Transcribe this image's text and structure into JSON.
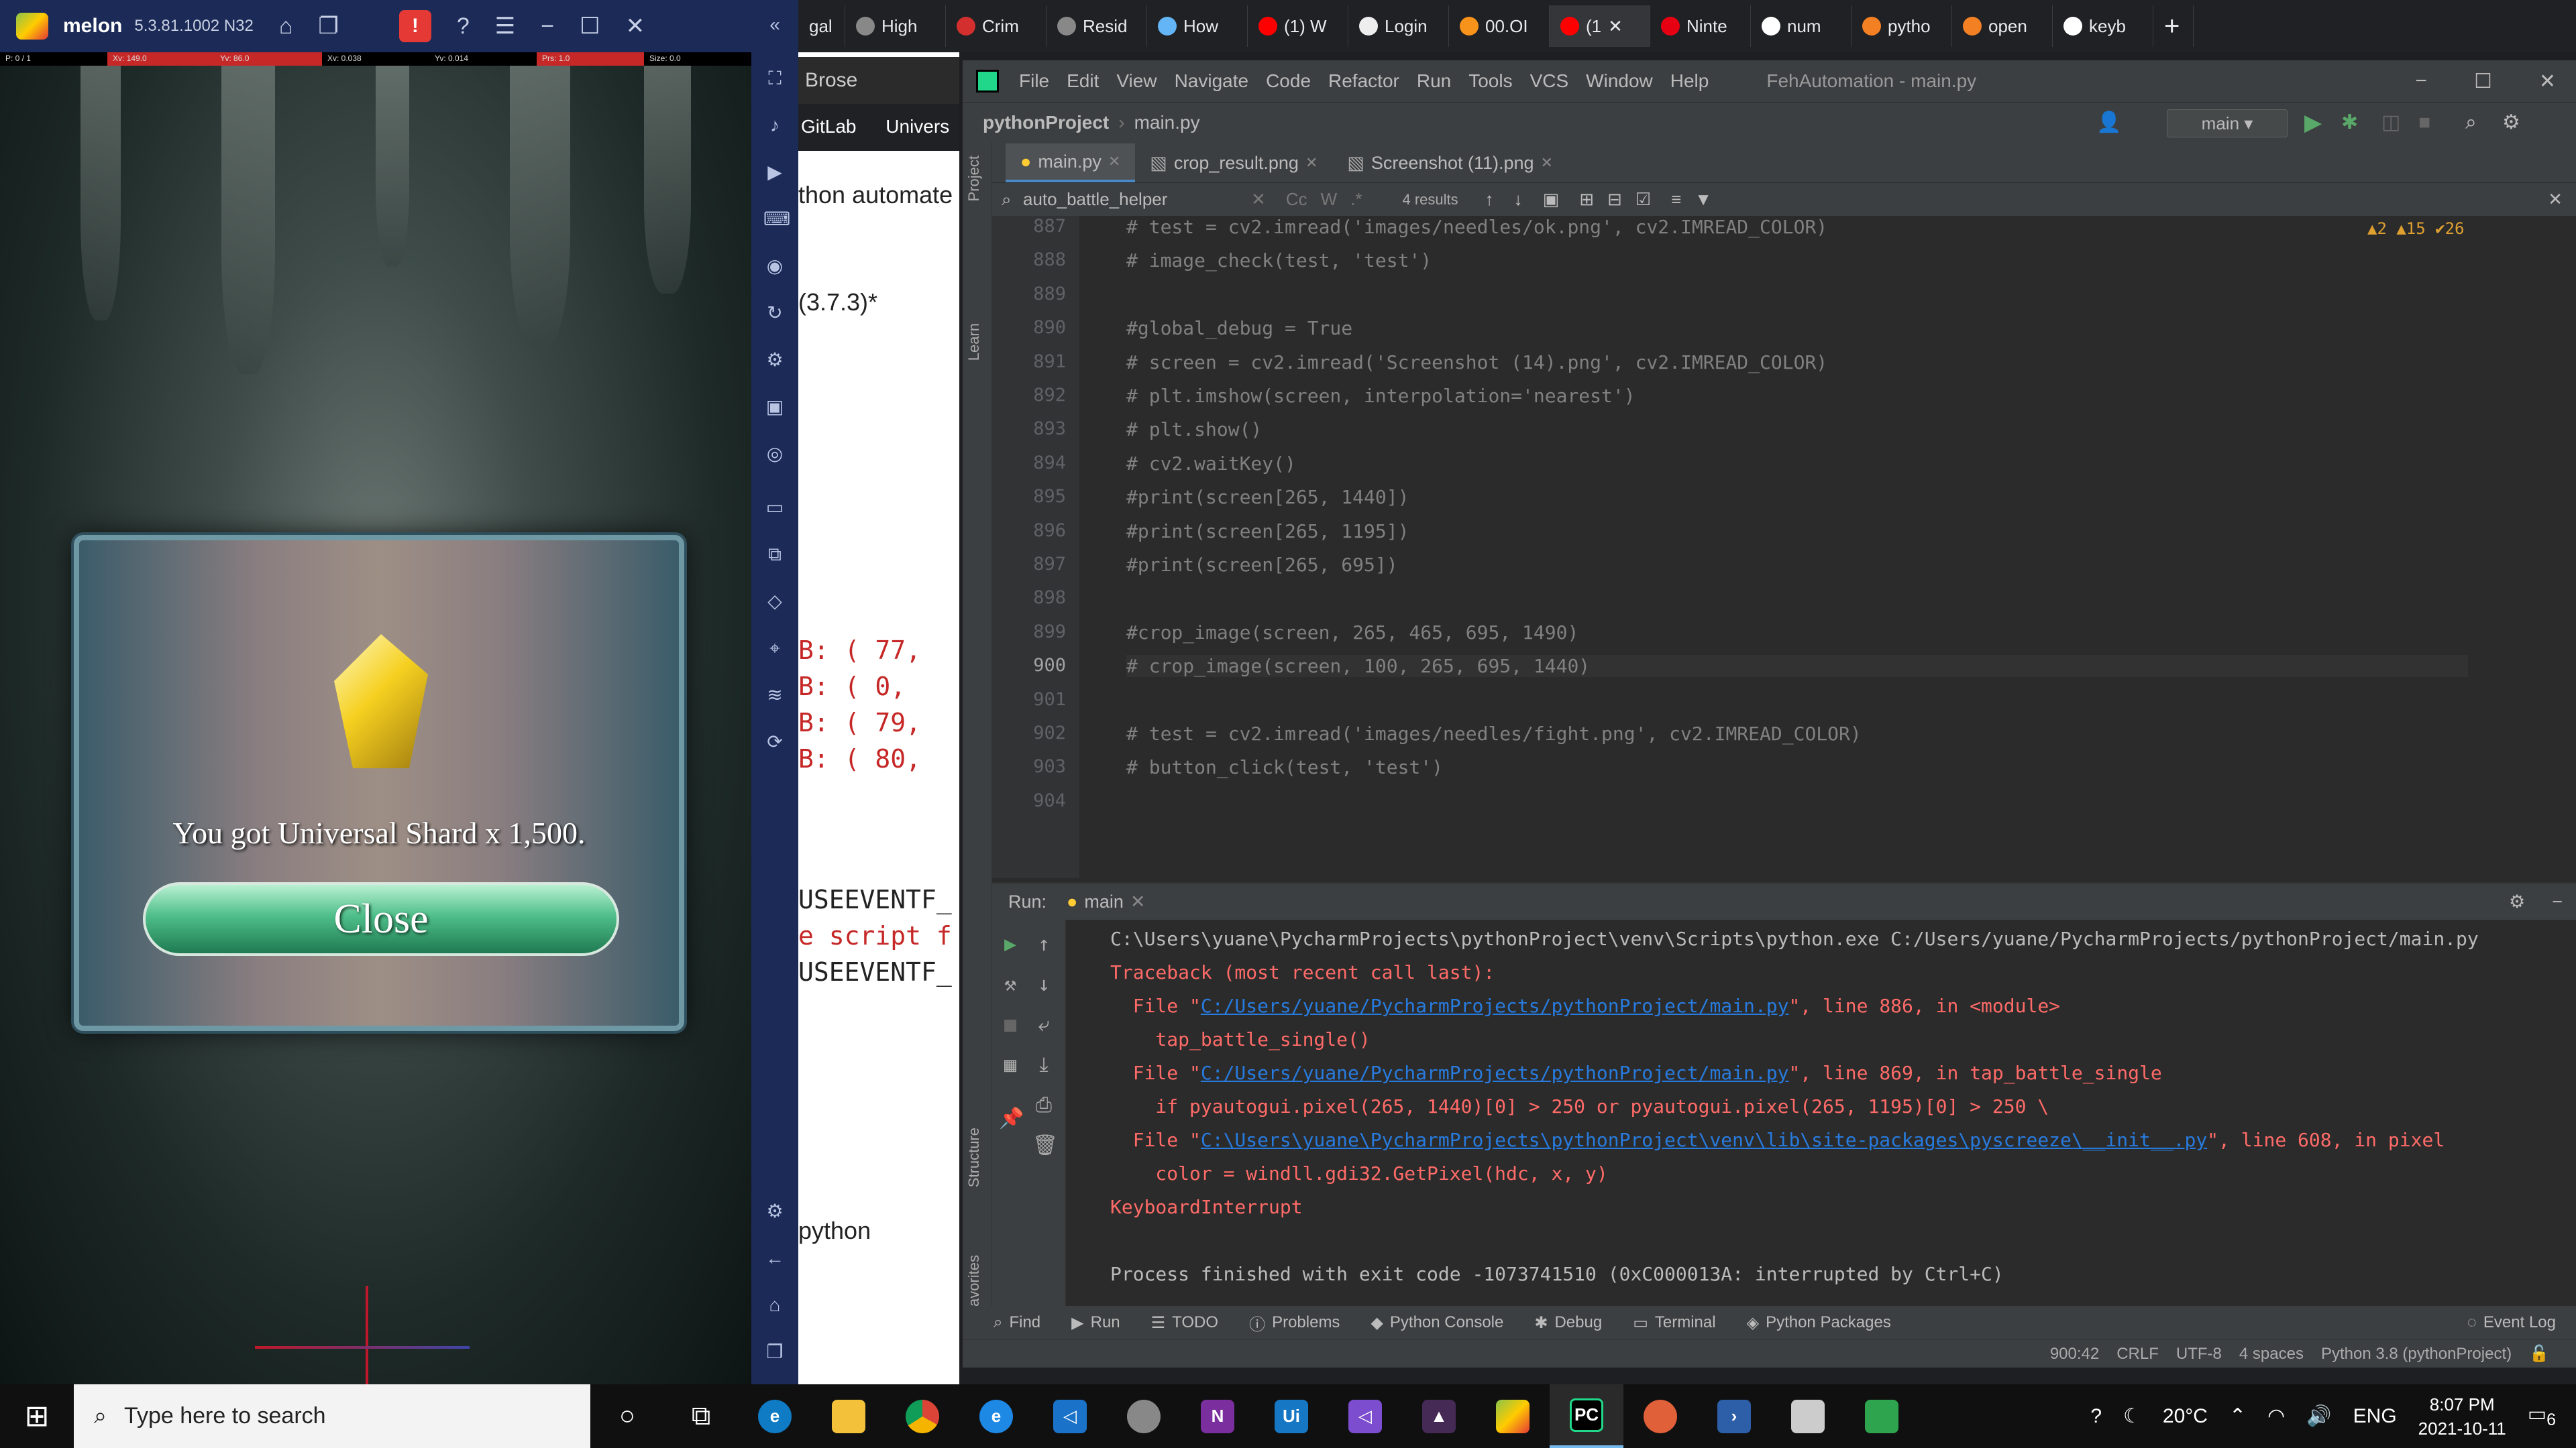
{
  "emulator": {
    "app_name": "melon",
    "version": "5.3.81.1002 N32",
    "debug_fields": [
      "P: 0 / 1",
      "Xv: 149.0",
      "Yv: 86.0",
      "Xv: 0.038",
      "Yv: 0.014",
      "Prs: 1.0",
      "Size: 0.0"
    ],
    "dialog_message": "You got Universal Shard x 1,500.",
    "close_label": "Close"
  },
  "chrome": {
    "tabs": [
      "gal",
      "High",
      "Crim",
      "Resid",
      "How",
      "(1) W",
      "Login",
      "00.OI",
      "(1",
      "Ninte",
      "num",
      "pytho",
      "open",
      "keyb"
    ],
    "brose_label": "Brose",
    "bookmarks": [
      "GitLab",
      "Univers"
    ],
    "page_fragments": {
      "heading": "thon automate g",
      "version": "(3.7.3)*",
      "code_lines": [
        "B: ( 77,",
        "B: (  0,",
        "B: ( 79,",
        "B: ( 80,"
      ],
      "event_lines": [
        "USEEVENTF_",
        "e script f",
        "USEEVENTF_"
      ],
      "python_word": "python"
    }
  },
  "pycharm": {
    "menu": [
      "File",
      "Edit",
      "View",
      "Navigate",
      "Code",
      "Refactor",
      "Run",
      "Tools",
      "VCS",
      "Window",
      "Help"
    ],
    "window_title": "FehAutomation - main.py",
    "project": "pythonProject",
    "file": "main.py",
    "run_config": "main",
    "tabs": [
      "main.py",
      "crop_result.png",
      "Screenshot (11).png"
    ],
    "search_query": "auto_battle_helper",
    "search_results": "4 results",
    "inspections": "▲2  ▲15  ✔26",
    "left_strip": [
      "Project",
      "Learn",
      "Structure",
      "Favorites"
    ],
    "lines": [
      {
        "n": "887",
        "code": "# test = cv2.imread('images/needles/ok.png', cv2.IMREAD_COLOR)"
      },
      {
        "n": "888",
        "code": "# image_check(test, 'test')"
      },
      {
        "n": "889",
        "code": ""
      },
      {
        "n": "890",
        "code": "#global_debug = True"
      },
      {
        "n": "891",
        "code": "# screen = cv2.imread('Screenshot (14).png', cv2.IMREAD_COLOR)"
      },
      {
        "n": "892",
        "code": "# plt.imshow(screen, interpolation='nearest')"
      },
      {
        "n": "893",
        "code": "# plt.show()"
      },
      {
        "n": "894",
        "code": "# cv2.waitKey()"
      },
      {
        "n": "895",
        "code": "#print(screen[265, 1440])"
      },
      {
        "n": "896",
        "code": "#print(screen[265, 1195])"
      },
      {
        "n": "897",
        "code": "#print(screen[265, 695])"
      },
      {
        "n": "898",
        "code": ""
      },
      {
        "n": "899",
        "code": "#crop_image(screen, 265, 465, 695, 1490)"
      },
      {
        "n": "900",
        "code": "# crop_image(screen, 100, 265, 695, 1440)"
      },
      {
        "n": "901",
        "code": ""
      },
      {
        "n": "902",
        "code": "# test = cv2.imread('images/needles/fight.png', cv2.IMREAD_COLOR)"
      },
      {
        "n": "903",
        "code": "# button_click(test, 'test')"
      },
      {
        "n": "904",
        "code": ""
      }
    ],
    "run": {
      "label": "Run:",
      "tab": "main",
      "cmd": "C:\\Users\\yuane\\PycharmProjects\\pythonProject\\venv\\Scripts\\python.exe C:/Users/yuane/PycharmProjects/pythonProject/main.py",
      "tb_header": "Traceback (most recent call last):",
      "f1_pre": "  File \"",
      "f1_link": "C:/Users/yuane/PycharmProjects/pythonProject/main.py",
      "f1_post": "\", line 886, in <module>",
      "f1_code": "    tap_battle_single()",
      "f2_pre": "  File \"",
      "f2_link": "C:/Users/yuane/PycharmProjects/pythonProject/main.py",
      "f2_post": "\", line 869, in tap_battle_single",
      "f2_code": "    if pyautogui.pixel(265, 1440)[0] > 250 or pyautogui.pixel(265, 1195)[0] > 250 \\",
      "f3_pre": "  File \"",
      "f3_link": "C:\\Users\\yuane\\PycharmProjects\\pythonProject\\venv\\lib\\site-packages\\pyscreeze\\__init__.py",
      "f3_post": "\", line 608, in pixel",
      "f3_code": "    color = windll.gdi32.GetPixel(hdc, x, y)",
      "interrupt": "KeyboardInterrupt",
      "finished": "Process finished with exit code -1073741510 (0xC000013A: interrupted by Ctrl+C)"
    },
    "bottom_tools": [
      "Find",
      "Run",
      "TODO",
      "Problems",
      "Python Console",
      "Debug",
      "Terminal",
      "Python Packages"
    ],
    "event_log": "Event Log",
    "status": [
      "900:42",
      "CRLF",
      "UTF-8",
      "4 spaces",
      "Python 3.8 (pythonProject)"
    ]
  },
  "taskbar": {
    "search_placeholder": "Type here to search",
    "weather": "20°C",
    "lang": "ENG",
    "time": "8:07 PM",
    "date": "2021-10-11",
    "notifications": "6"
  }
}
